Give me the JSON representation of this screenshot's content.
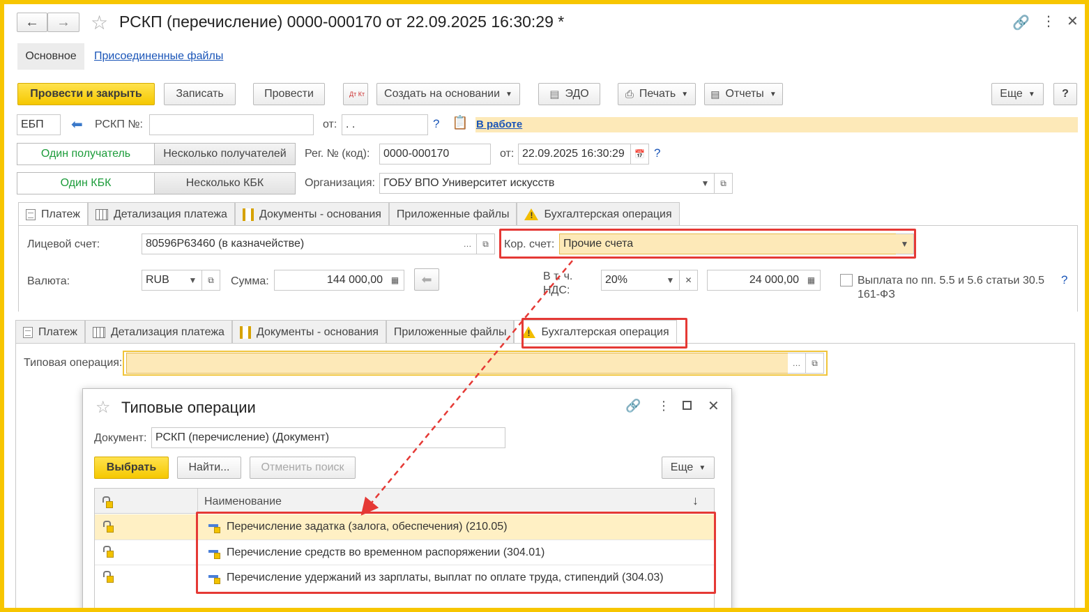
{
  "window": {
    "title": "РСКП (перечисление) 0000-000170 от 22.09.2025 16:30:29 *"
  },
  "nav": {
    "main_tab": "Основное",
    "attached_link": "Присоединенные файлы"
  },
  "toolbar": {
    "post_close": "Провести и закрыть",
    "save": "Записать",
    "post": "Провести",
    "dtkt": "Дт Кт",
    "create_based": "Создать на основании",
    "edo": "ЭДО",
    "print": "Печать",
    "reports": "Отчеты",
    "more": "Еще",
    "help": "?"
  },
  "header": {
    "ebp": "ЕБП",
    "rskp_label": "РСКП №:",
    "rskp_value": "",
    "from_label": "от:",
    "from_value": " .  .",
    "status_link": "В работе",
    "q": "?",
    "one_recipient": "Один получатель",
    "many_recipients": "Несколько получателей",
    "reg_label": "Рег. № (код):",
    "reg_value": "0000-000170",
    "date_label": "от:",
    "date_value": "22.09.2025 16:30:29",
    "one_kbk": "Один КБК",
    "many_kbk": "Несколько КБК",
    "org_label": "Организация:",
    "org_value": "ГОБУ ВПО Университет искусств"
  },
  "tabs": [
    {
      "label": "Платеж"
    },
    {
      "label": "Детализация платежа"
    },
    {
      "label": "Документы - основания"
    },
    {
      "label": "Приложенные файлы"
    },
    {
      "label": "Бухгалтерская операция"
    }
  ],
  "payment": {
    "account_label": "Лицевой счет:",
    "account_value": "80596Р63460 (в казначействе)",
    "kor_label": "Кор. счет:",
    "kor_value": "Прочие счета",
    "currency_label": "Валюта:",
    "currency_value": "RUB",
    "sum_label": "Сумма:",
    "sum_value": "144 000,00",
    "vat_label_1": "В т. ч.",
    "vat_label_2": "НДС:",
    "vat_rate": "20%",
    "vat_sum": "24 000,00",
    "payout_label_1": "Выплата по пп. 5.5 и 5.6 статьи 30.5",
    "payout_label_2": "161-ФЗ",
    "q": "?"
  },
  "operation": {
    "label": "Типовая операция:",
    "value": ""
  },
  "dialog": {
    "title": "Типовые операции",
    "doc_label": "Документ:",
    "doc_value": "РСКП (перечисление) (Документ)",
    "select": "Выбрать",
    "find": "Найти...",
    "cancel_search": "Отменить поиск",
    "more": "Еще",
    "col_name": "Наименование",
    "sort_icon": "↓",
    "rows": [
      {
        "name": "Перечисление задатка (залога, обеспечения) (210.05)"
      },
      {
        "name": "Перечисление средств во временном распоряжении (304.01)"
      },
      {
        "name": "Перечисление удержаний из зарплаты, выплат по оплате труда, стипендий (304.03)"
      }
    ]
  },
  "colors": {
    "frame": "#f7c600",
    "highlight_field": "#fde9b8",
    "red_box": "#e53935",
    "green_text": "#1c9c3a",
    "link": "#1a55b8"
  }
}
